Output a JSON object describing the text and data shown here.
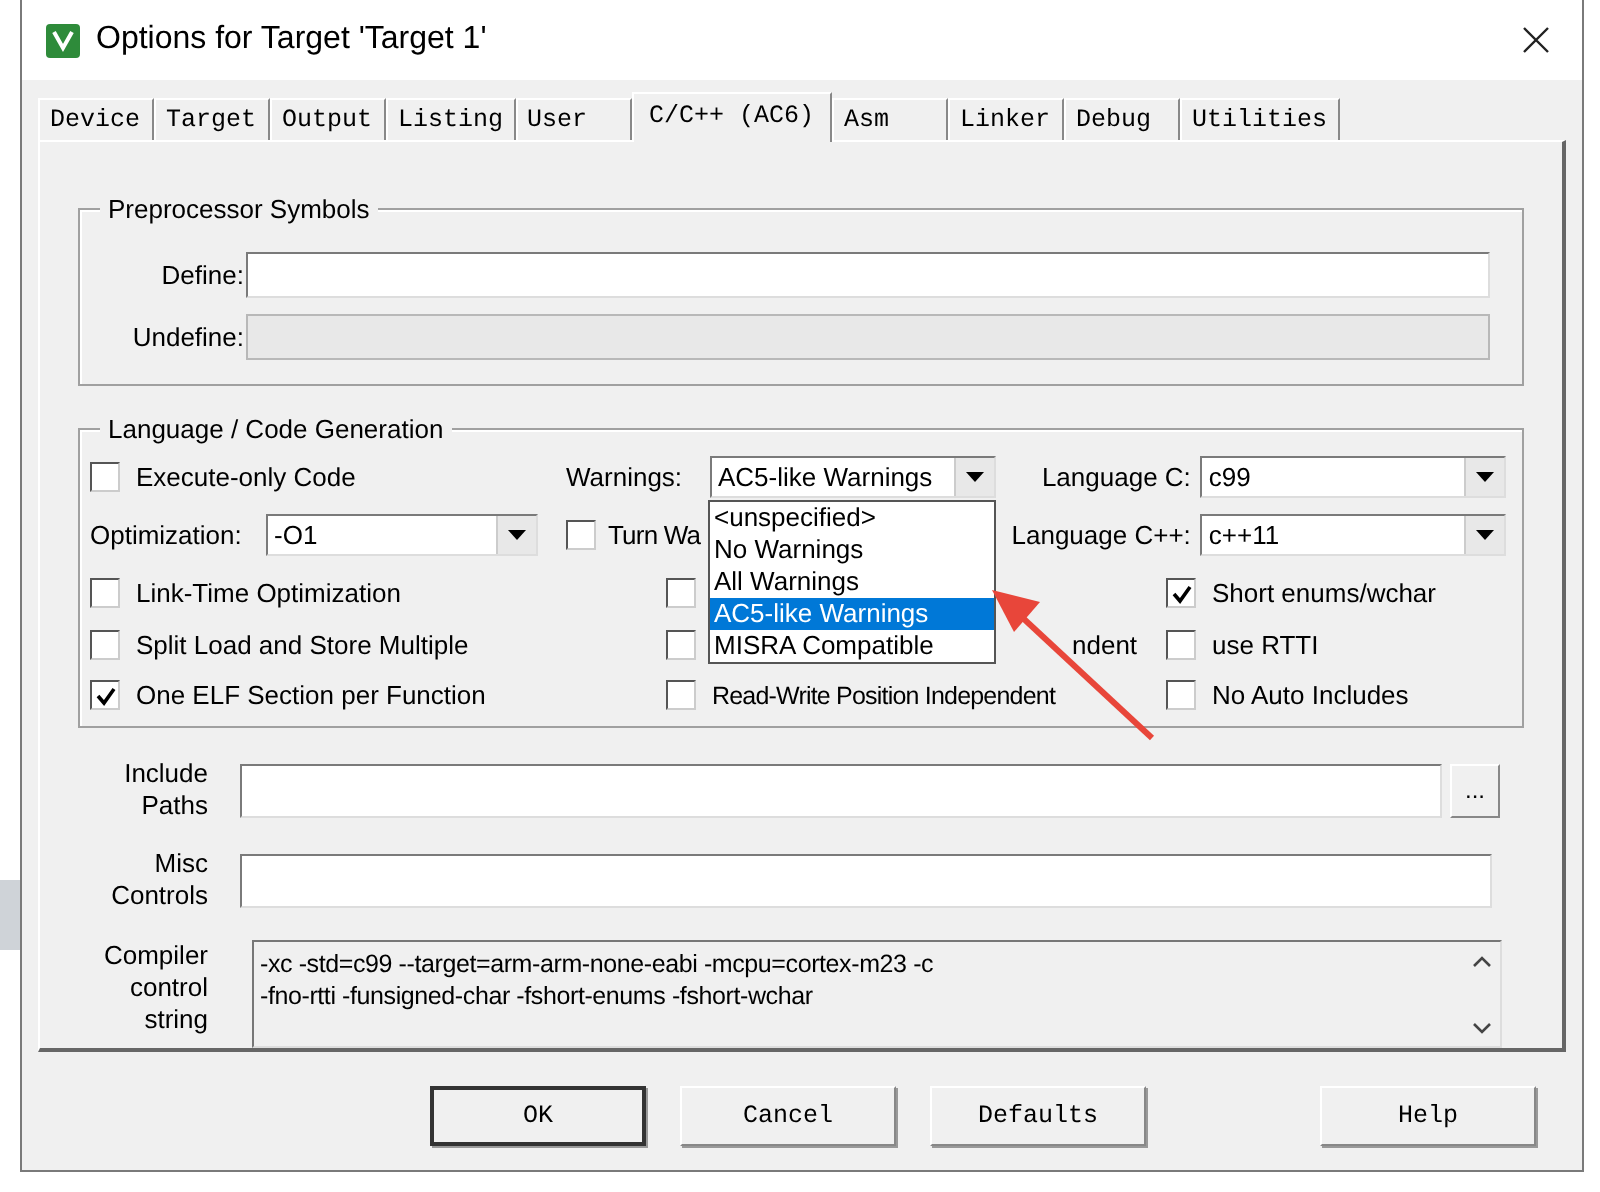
{
  "window": {
    "title": "Options for Target 'Target 1'"
  },
  "tabs": [
    {
      "label": "Device",
      "selected": false
    },
    {
      "label": "Target",
      "selected": false
    },
    {
      "label": "Output",
      "selected": false
    },
    {
      "label": "Listing",
      "selected": false
    },
    {
      "label": "User",
      "selected": false
    },
    {
      "label": "C/C++ (AC6)",
      "selected": true
    },
    {
      "label": "Asm",
      "selected": false
    },
    {
      "label": "Linker",
      "selected": false
    },
    {
      "label": "Debug",
      "selected": false
    },
    {
      "label": "Utilities",
      "selected": false
    }
  ],
  "preprocessor": {
    "title": "Preprocessor Symbols",
    "fields": [
      {
        "label": "Define:",
        "disabled": false
      },
      {
        "label": "Undefine:",
        "disabled": true
      }
    ]
  },
  "language": {
    "title": "Language / Code Generation",
    "cells": [
      {
        "kind": "checkbox",
        "label": "Execute-only Code",
        "checked": false
      },
      {
        "kind": "combo",
        "label": "Warnings:",
        "value": "AC5-like Warnings"
      },
      {
        "kind": "combo",
        "label": "Language C:",
        "value": "c99"
      },
      {
        "kind": "combo",
        "label": "Optimization:",
        "value": "-O1"
      },
      {
        "kind": "checkbox",
        "label": "Turn Wa",
        "checked": false
      },
      {
        "kind": "combo",
        "label": "Language C++:",
        "value": "c++11"
      },
      {
        "kind": "checkbox",
        "label": "Link-Time Optimization",
        "checked": false
      },
      {
        "kind": "checkbox",
        "checked": false
      },
      {
        "kind": "checkbox",
        "label": "Short enums/wchar",
        "checked": true
      },
      {
        "kind": "checkbox",
        "label": "Split Load and Store Multiple",
        "checked": false
      },
      {
        "kind": "checkbox",
        "label": "ndent",
        "checked": false
      },
      {
        "kind": "checkbox",
        "label": "use RTTI",
        "checked": false
      },
      {
        "kind": "checkbox",
        "label": "One ELF Section per Function",
        "checked": true
      },
      {
        "kind": "checkbox",
        "label": "Read-Write Position Independent",
        "checked": false
      },
      {
        "kind": "checkbox",
        "label": "No Auto Includes",
        "checked": false
      }
    ],
    "warnings_list": [
      {
        "label": "<unspecified>",
        "selected": false
      },
      {
        "label": "No Warnings",
        "selected": false
      },
      {
        "label": "All Warnings",
        "selected": false
      },
      {
        "label": "AC5-like Warnings",
        "selected": true
      },
      {
        "label": "MISRA Compatible",
        "selected": false
      }
    ]
  },
  "include_paths": {
    "label": "Include Paths",
    "browse": "..."
  },
  "misc_controls": {
    "label": "Misc Controls"
  },
  "compiler_control": {
    "label": "Compiler control string",
    "lines": [
      "-xc -std=c99 --target=arm-arm-none-eabi -mcpu=cortex-m23 -c",
      "-fno-rtti -funsigned-char -fshort-enums -fshort-wchar"
    ]
  },
  "buttons": [
    "OK",
    "Cancel",
    "Defaults",
    "Help"
  ]
}
